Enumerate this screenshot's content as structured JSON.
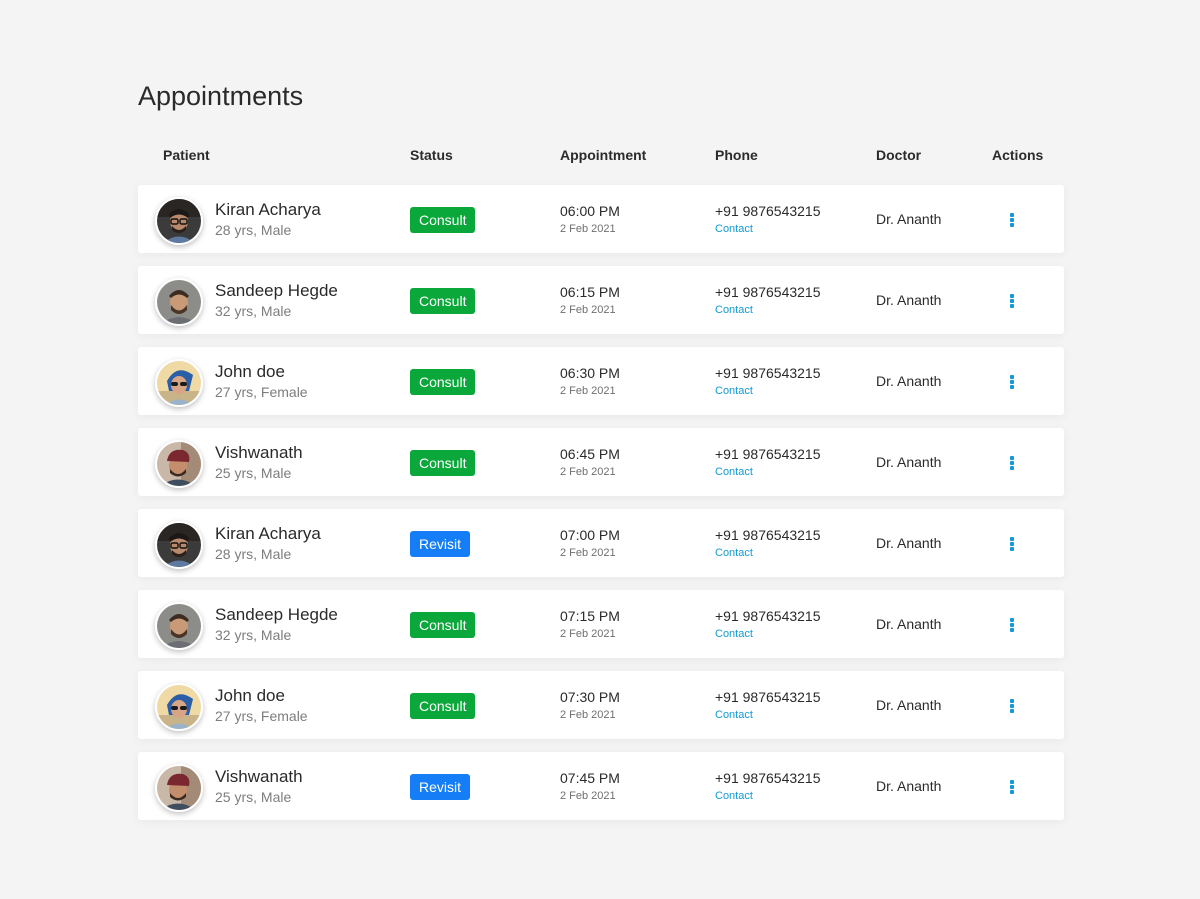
{
  "page": {
    "title": "Appointments"
  },
  "columns": {
    "patient": "Patient",
    "status": "Status",
    "appointment": "Appointment",
    "phone": "Phone",
    "doctor": "Doctor",
    "actions": "Actions"
  },
  "colors": {
    "consult": "#0aa73b",
    "revisit": "#157ef6",
    "link": "#139ad6"
  },
  "appointments": [
    {
      "name": "Kiran Acharya",
      "meta": "28 yrs, Male",
      "status": "Consult",
      "time": "06:00 PM",
      "date": "2 Feb 2021",
      "phone": "+91 9876543215",
      "contact": "Contact",
      "doctor": "Dr. Ananth",
      "avatar": "kiran"
    },
    {
      "name": "Sandeep Hegde",
      "meta": "32 yrs, Male",
      "status": "Consult",
      "time": "06:15 PM",
      "date": "2 Feb 2021",
      "phone": "+91 9876543215",
      "contact": "Contact",
      "doctor": "Dr. Ananth",
      "avatar": "sandeep"
    },
    {
      "name": "John doe",
      "meta": "27 yrs, Female",
      "status": "Consult",
      "time": "06:30 PM",
      "date": "2 Feb 2021",
      "phone": "+91 9876543215",
      "contact": "Contact",
      "doctor": "Dr. Ananth",
      "avatar": "john"
    },
    {
      "name": "Vishwanath",
      "meta": "25 yrs, Male",
      "status": "Consult",
      "time": "06:45 PM",
      "date": "2 Feb 2021",
      "phone": "+91 9876543215",
      "contact": "Contact",
      "doctor": "Dr. Ananth",
      "avatar": "vishwanath"
    },
    {
      "name": "Kiran Acharya",
      "meta": "28 yrs, Male",
      "status": "Revisit",
      "time": "07:00 PM",
      "date": "2 Feb 2021",
      "phone": "+91 9876543215",
      "contact": "Contact",
      "doctor": "Dr. Ananth",
      "avatar": "kiran"
    },
    {
      "name": "Sandeep Hegde",
      "meta": "32 yrs, Male",
      "status": "Consult",
      "time": "07:15 PM",
      "date": "2 Feb 2021",
      "phone": "+91 9876543215",
      "contact": "Contact",
      "doctor": "Dr. Ananth",
      "avatar": "sandeep"
    },
    {
      "name": "John doe",
      "meta": "27 yrs, Female",
      "status": "Consult",
      "time": "07:30 PM",
      "date": "2 Feb 2021",
      "phone": "+91 9876543215",
      "contact": "Contact",
      "doctor": "Dr. Ananth",
      "avatar": "john"
    },
    {
      "name": "Vishwanath",
      "meta": "25 yrs, Male",
      "status": "Revisit",
      "time": "07:45 PM",
      "date": "2 Feb 2021",
      "phone": "+91 9876543215",
      "contact": "Contact",
      "doctor": "Dr. Ananth",
      "avatar": "vishwanath"
    }
  ],
  "icons": {
    "row_actions": "more-vertical-icon"
  }
}
